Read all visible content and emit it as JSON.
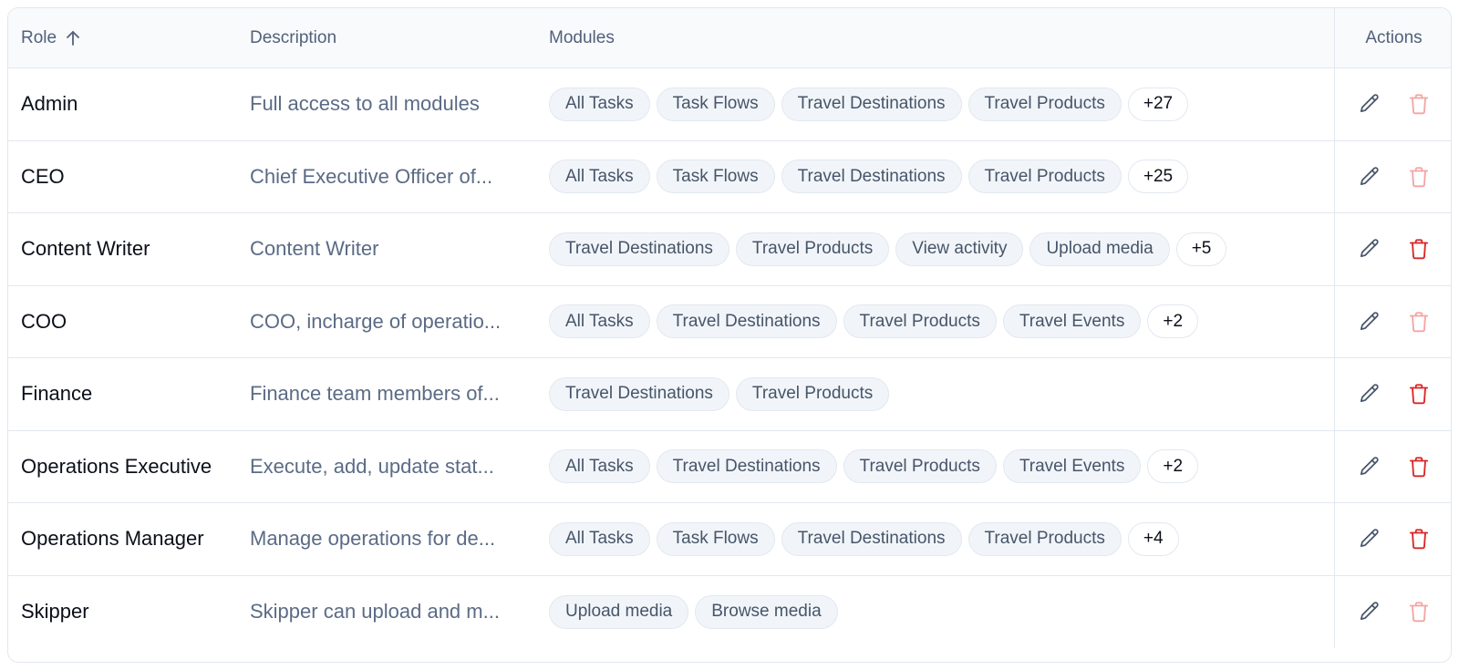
{
  "header": {
    "role": "Role",
    "description": "Description",
    "modules": "Modules",
    "actions": "Actions",
    "sort_icon": "arrow-up-icon"
  },
  "icons": {
    "edit": "pencil-icon",
    "delete": "trash-icon"
  },
  "colors": {
    "delete_enabled": "#dc2626",
    "delete_disabled": "#f4a5a5",
    "edit": "#475569",
    "chip_bg": "#f1f5f9",
    "border": "#e2e8f0"
  },
  "rows": [
    {
      "role": "Admin",
      "description": "Full access to all modules",
      "modules": [
        "All Tasks",
        "Task Flows",
        "Travel Destinations",
        "Travel Products"
      ],
      "more": "+27",
      "delete_enabled": false
    },
    {
      "role": "CEO",
      "description": "Chief Executive Officer of...",
      "modules": [
        "All Tasks",
        "Task Flows",
        "Travel Destinations",
        "Travel Products"
      ],
      "more": "+25",
      "delete_enabled": false
    },
    {
      "role": "Content Writer",
      "description": "Content Writer",
      "modules": [
        "Travel Destinations",
        "Travel Products",
        "View activity",
        "Upload media"
      ],
      "more": "+5",
      "delete_enabled": true
    },
    {
      "role": "COO",
      "description": "COO, incharge of operatio...",
      "modules": [
        "All Tasks",
        "Travel Destinations",
        "Travel Products",
        "Travel Events"
      ],
      "more": "+2",
      "delete_enabled": false
    },
    {
      "role": "Finance",
      "description": "Finance team members of...",
      "modules": [
        "Travel Destinations",
        "Travel Products"
      ],
      "more": "",
      "delete_enabled": true
    },
    {
      "role": "Operations Executive",
      "description": "Execute, add, update stat...",
      "modules": [
        "All Tasks",
        "Travel Destinations",
        "Travel Products",
        "Travel Events"
      ],
      "more": "+2",
      "delete_enabled": true
    },
    {
      "role": "Operations Manager",
      "description": "Manage operations for de...",
      "modules": [
        "All Tasks",
        "Task Flows",
        "Travel Destinations",
        "Travel Products"
      ],
      "more": "+4",
      "delete_enabled": true
    },
    {
      "role": "Skipper",
      "description": "Skipper can upload and m...",
      "modules": [
        "Upload media",
        "Browse media"
      ],
      "more": "",
      "delete_enabled": false
    }
  ]
}
